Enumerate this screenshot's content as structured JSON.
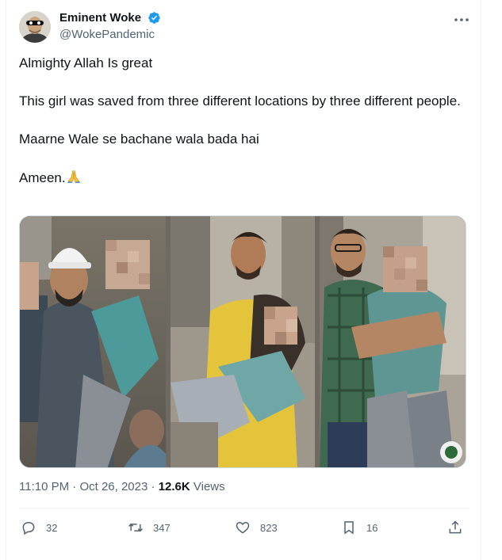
{
  "author": {
    "display_name": "Eminent Woke",
    "handle": "@WokePandemic",
    "verified": true
  },
  "tweet": {
    "paragraphs": [
      "Almighty Allah Is great",
      "This girl was saved from three different locations by three different people.",
      "Maarne Wale se bachane wala bada hai",
      "Ameen."
    ],
    "emoji": "folded-hands"
  },
  "meta": {
    "time": "11:10 PM",
    "separator": "·",
    "date": "Oct 26, 2023",
    "views_count": "12.6K",
    "views_label": "Views"
  },
  "actions": {
    "replies": "32",
    "retweets": "347",
    "likes": "823",
    "bookmarks": "16"
  },
  "colors": {
    "text": "#0f1419",
    "secondary": "#536471",
    "verified_blue": "#1d9bf0",
    "divider": "#eff3f4"
  }
}
